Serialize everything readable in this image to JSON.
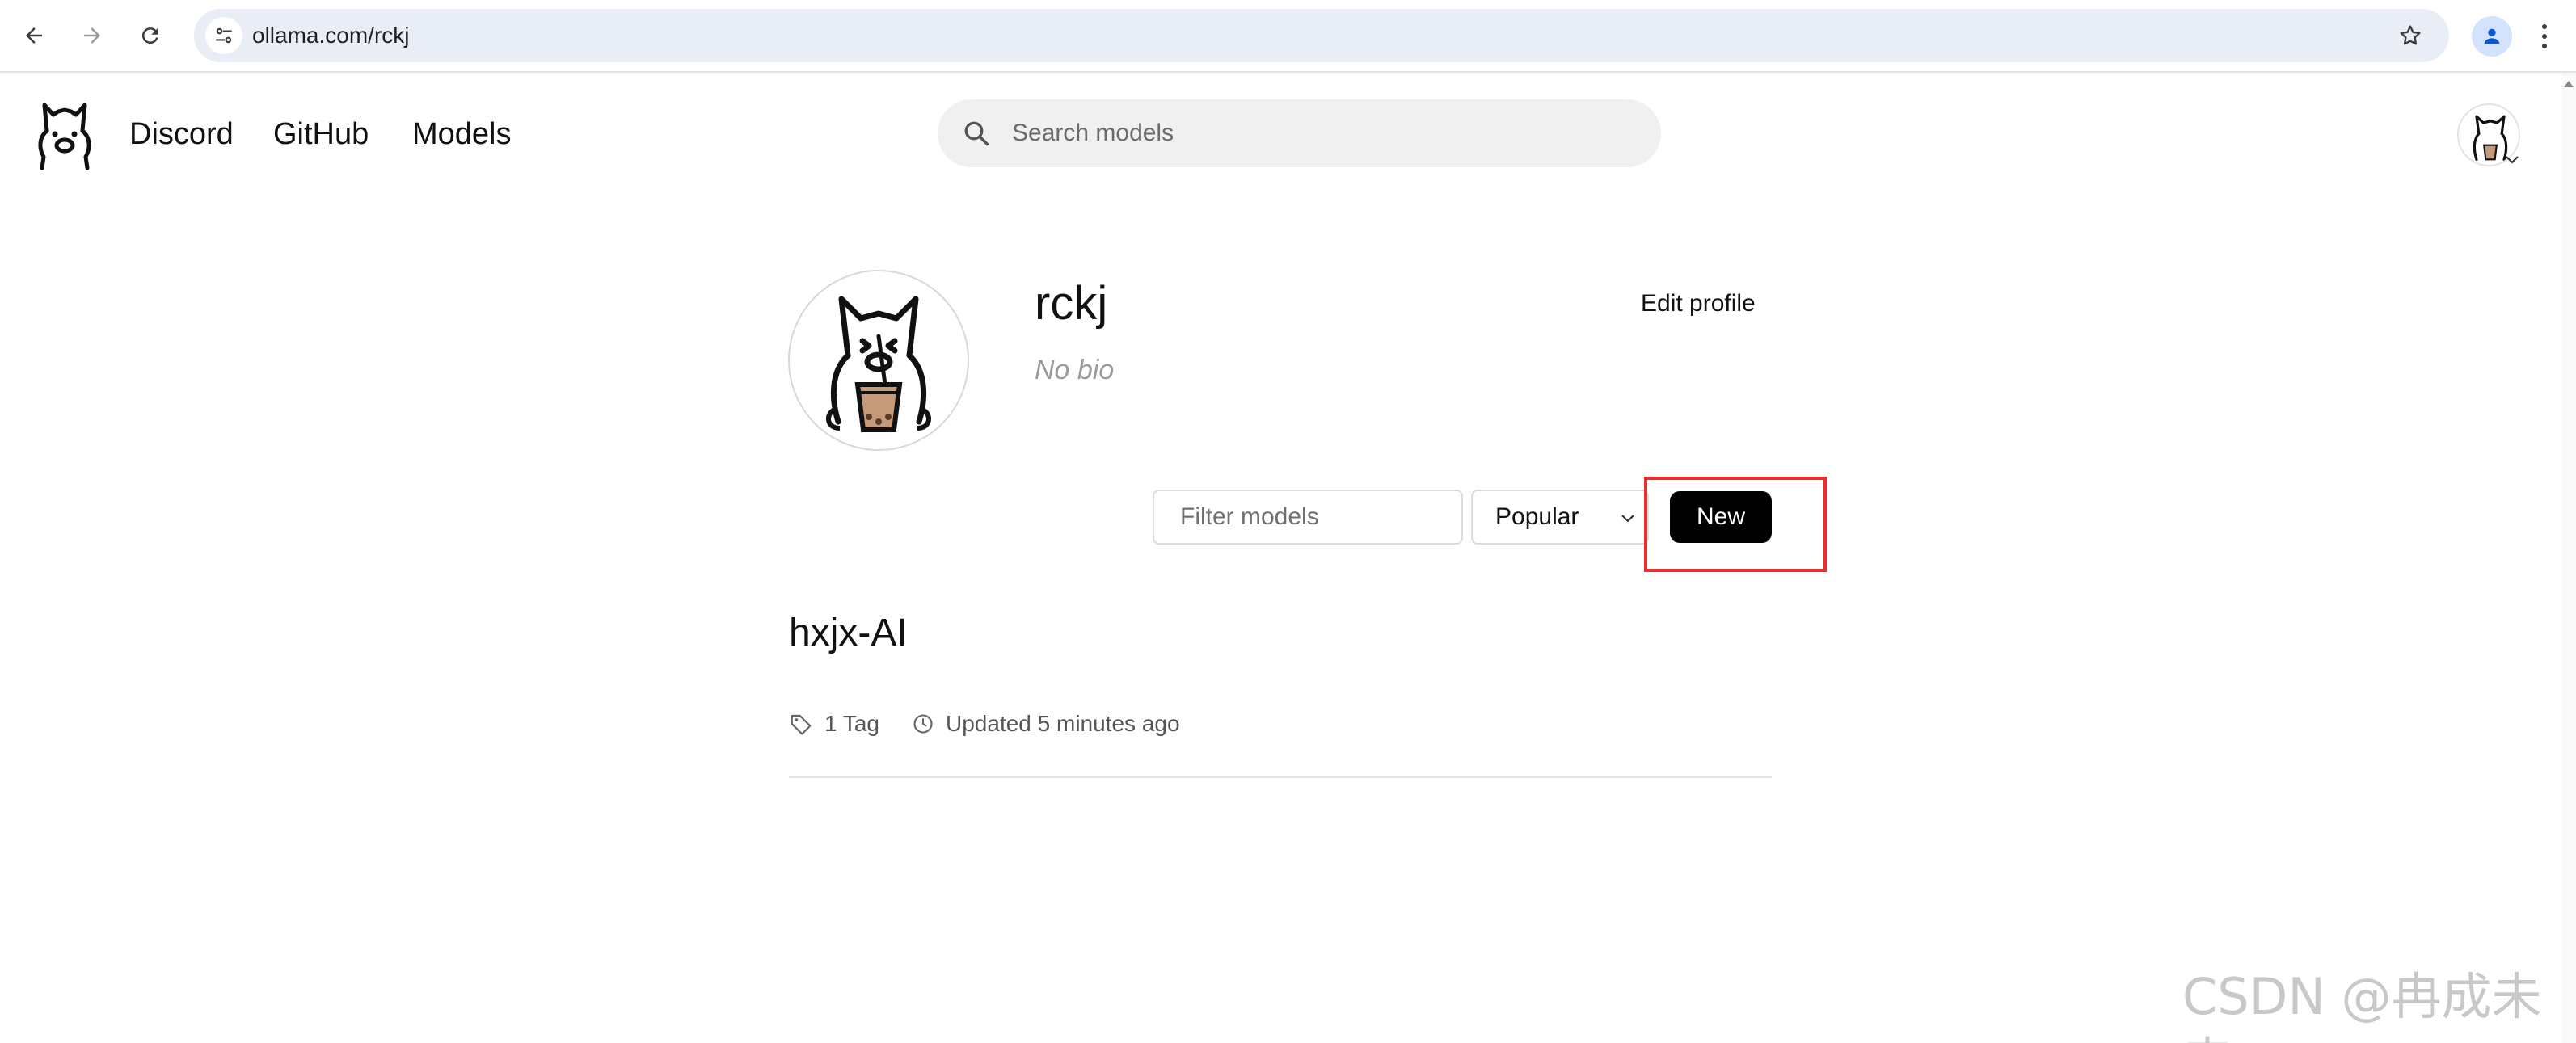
{
  "browser": {
    "url": "ollama.com/rckj",
    "back_icon": "arrow-left-icon",
    "forward_icon": "arrow-right-icon",
    "reload_icon": "reload-icon",
    "star_icon": "star-icon",
    "profile_icon": "person-icon",
    "menu_icon": "kebab-icon"
  },
  "header": {
    "links": [
      "Discord",
      "GitHub",
      "Models"
    ],
    "search_placeholder": "Search models"
  },
  "profile": {
    "username": "rckj",
    "bio": "No bio",
    "edit_label": "Edit profile"
  },
  "controls": {
    "filter_placeholder": "Filter models",
    "sort_value": "Popular",
    "new_label": "New"
  },
  "models": [
    {
      "name": "hxjx-AI",
      "tags": "1 Tag",
      "updated": "Updated 5 minutes ago"
    }
  ],
  "watermark": "CSDN @冉成未来",
  "colors": {
    "highlight": "#e8312f",
    "omnibox": "#e9eef6",
    "button": "#000000"
  }
}
